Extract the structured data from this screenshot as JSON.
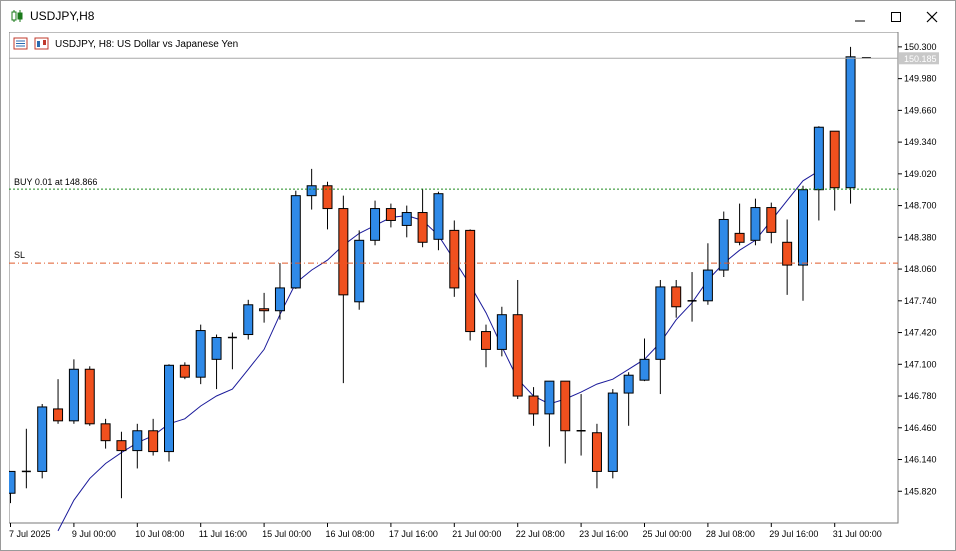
{
  "window": {
    "title": "USDJPY,H8",
    "controls": [
      "minimize",
      "maximize",
      "close"
    ]
  },
  "chart_header": {
    "text": "USDJPY, H8:  US Dollar vs Japanese Yen"
  },
  "price_lines": {
    "buy": {
      "label": "BUY 0.01 at 148.866",
      "price": 148.866,
      "color": "#1c8a1c"
    },
    "sl": {
      "label": "SL",
      "price": 148.12,
      "color": "#e05a2a"
    },
    "current": {
      "label": "150.185",
      "price": 150.185
    }
  },
  "colors": {
    "bull": "#2f8ae8",
    "bear": "#f0501e",
    "ma": "#1a1a9a",
    "wick": "#000000"
  },
  "chart_data": {
    "type": "candlestick",
    "symbol": "USDJPY",
    "timeframe": "H8",
    "ylim": [
      145.5,
      150.45
    ],
    "y_ticks": [
      150.3,
      149.98,
      149.66,
      149.34,
      149.02,
      148.7,
      148.38,
      148.06,
      147.74,
      147.42,
      147.1,
      146.78,
      146.46,
      146.14,
      145.82
    ],
    "x_ticks": [
      {
        "i": 0,
        "label": "7 Jul 2025"
      },
      {
        "i": 4,
        "label": "9 Jul 00:00"
      },
      {
        "i": 8,
        "label": "10 Jul 08:00"
      },
      {
        "i": 12,
        "label": "11 Jul 16:00"
      },
      {
        "i": 16,
        "label": "15 Jul 00:00"
      },
      {
        "i": 20,
        "label": "16 Jul 08:00"
      },
      {
        "i": 24,
        "label": "17 Jul 16:00"
      },
      {
        "i": 28,
        "label": "21 Jul 00:00"
      },
      {
        "i": 32,
        "label": "22 Jul 08:00"
      },
      {
        "i": 36,
        "label": "23 Jul 16:00"
      },
      {
        "i": 40,
        "label": "25 Jul 00:00"
      },
      {
        "i": 44,
        "label": "28 Jul 08:00"
      },
      {
        "i": 48,
        "label": "29 Jul 16:00"
      },
      {
        "i": 52,
        "label": "31 Jul 00:00"
      }
    ],
    "candles": [
      {
        "o": 145.8,
        "h": 146.02,
        "l": 145.7,
        "c": 146.02
      },
      {
        "o": 146.02,
        "h": 146.45,
        "l": 145.85,
        "c": 146.02
      },
      {
        "o": 146.02,
        "h": 146.7,
        "l": 145.95,
        "c": 146.67
      },
      {
        "o": 146.65,
        "h": 146.95,
        "l": 146.5,
        "c": 146.53
      },
      {
        "o": 146.53,
        "h": 147.15,
        "l": 146.5,
        "c": 147.05
      },
      {
        "o": 147.05,
        "h": 147.08,
        "l": 146.48,
        "c": 146.5
      },
      {
        "o": 146.5,
        "h": 146.55,
        "l": 146.25,
        "c": 146.33
      },
      {
        "o": 146.33,
        "h": 146.42,
        "l": 145.75,
        "c": 146.23
      },
      {
        "o": 146.23,
        "h": 146.5,
        "l": 146.05,
        "c": 146.43
      },
      {
        "o": 146.43,
        "h": 146.55,
        "l": 146.18,
        "c": 146.22
      },
      {
        "o": 146.22,
        "h": 147.1,
        "l": 146.12,
        "c": 147.09
      },
      {
        "o": 147.09,
        "h": 147.12,
        "l": 146.95,
        "c": 146.97
      },
      {
        "o": 146.97,
        "h": 147.5,
        "l": 146.9,
        "c": 147.44
      },
      {
        "o": 147.15,
        "h": 147.4,
        "l": 146.85,
        "c": 147.37
      },
      {
        "o": 147.37,
        "h": 147.42,
        "l": 147.05,
        "c": 147.37
      },
      {
        "o": 147.4,
        "h": 147.75,
        "l": 147.35,
        "c": 147.7
      },
      {
        "o": 147.66,
        "h": 147.82,
        "l": 147.52,
        "c": 147.64
      },
      {
        "o": 147.64,
        "h": 148.12,
        "l": 147.55,
        "c": 147.87
      },
      {
        "o": 147.87,
        "h": 148.85,
        "l": 147.86,
        "c": 148.8
      },
      {
        "o": 148.8,
        "h": 149.07,
        "l": 148.66,
        "c": 148.9
      },
      {
        "o": 148.9,
        "h": 148.94,
        "l": 148.46,
        "c": 148.67
      },
      {
        "o": 148.67,
        "h": 148.8,
        "l": 146.91,
        "c": 147.8
      },
      {
        "o": 147.73,
        "h": 148.45,
        "l": 147.65,
        "c": 148.35
      },
      {
        "o": 148.35,
        "h": 148.75,
        "l": 148.3,
        "c": 148.67
      },
      {
        "o": 148.67,
        "h": 148.72,
        "l": 148.48,
        "c": 148.55
      },
      {
        "o": 148.5,
        "h": 148.7,
        "l": 148.38,
        "c": 148.63
      },
      {
        "o": 148.63,
        "h": 148.87,
        "l": 148.28,
        "c": 148.33
      },
      {
        "o": 148.36,
        "h": 148.84,
        "l": 148.25,
        "c": 148.82
      },
      {
        "o": 148.45,
        "h": 148.55,
        "l": 147.78,
        "c": 147.87
      },
      {
        "o": 148.45,
        "h": 148.46,
        "l": 147.34,
        "c": 147.43
      },
      {
        "o": 147.43,
        "h": 147.5,
        "l": 147.07,
        "c": 147.25
      },
      {
        "o": 147.25,
        "h": 147.68,
        "l": 147.18,
        "c": 147.6
      },
      {
        "o": 147.6,
        "h": 147.95,
        "l": 146.75,
        "c": 146.78
      },
      {
        "o": 146.78,
        "h": 146.87,
        "l": 146.48,
        "c": 146.6
      },
      {
        "o": 146.6,
        "h": 146.93,
        "l": 146.27,
        "c": 146.93
      },
      {
        "o": 146.93,
        "h": 146.93,
        "l": 146.1,
        "c": 146.43
      },
      {
        "o": 146.43,
        "h": 146.8,
        "l": 146.18,
        "c": 146.43
      },
      {
        "o": 146.41,
        "h": 146.5,
        "l": 145.85,
        "c": 146.02
      },
      {
        "o": 146.02,
        "h": 146.85,
        "l": 145.95,
        "c": 146.81
      },
      {
        "o": 146.81,
        "h": 147.02,
        "l": 146.48,
        "c": 146.99
      },
      {
        "o": 146.94,
        "h": 147.36,
        "l": 146.93,
        "c": 147.15
      },
      {
        "o": 147.15,
        "h": 147.95,
        "l": 146.8,
        "c": 147.88
      },
      {
        "o": 147.88,
        "h": 147.95,
        "l": 147.57,
        "c": 147.68
      },
      {
        "o": 147.74,
        "h": 148.03,
        "l": 147.53,
        "c": 147.74
      },
      {
        "o": 147.74,
        "h": 148.32,
        "l": 147.7,
        "c": 148.05
      },
      {
        "o": 148.05,
        "h": 148.64,
        "l": 147.98,
        "c": 148.56
      },
      {
        "o": 148.42,
        "h": 148.72,
        "l": 148.3,
        "c": 148.33
      },
      {
        "o": 148.35,
        "h": 148.77,
        "l": 148.3,
        "c": 148.68
      },
      {
        "o": 148.68,
        "h": 148.73,
        "l": 148.32,
        "c": 148.43
      },
      {
        "o": 148.33,
        "h": 148.56,
        "l": 147.8,
        "c": 148.1
      },
      {
        "o": 148.1,
        "h": 148.9,
        "l": 147.74,
        "c": 148.86
      },
      {
        "o": 148.86,
        "h": 149.5,
        "l": 148.55,
        "c": 149.49
      },
      {
        "o": 149.45,
        "h": 149.45,
        "l": 148.65,
        "c": 148.88
      },
      {
        "o": 148.88,
        "h": 150.3,
        "l": 148.72,
        "c": 150.2
      },
      {
        "o": 150.19,
        "h": 150.19,
        "l": 150.19,
        "c": 150.19
      }
    ],
    "ma_line": [
      {
        "i": 3,
        "v": 145.42
      },
      {
        "i": 4,
        "v": 145.73
      },
      {
        "i": 5,
        "v": 145.95
      },
      {
        "i": 6,
        "v": 146.1
      },
      {
        "i": 7,
        "v": 146.21
      },
      {
        "i": 8,
        "v": 146.31
      },
      {
        "i": 9,
        "v": 146.38
      },
      {
        "i": 10,
        "v": 146.5
      },
      {
        "i": 11,
        "v": 146.55
      },
      {
        "i": 12,
        "v": 146.68
      },
      {
        "i": 13,
        "v": 146.78
      },
      {
        "i": 14,
        "v": 146.85
      },
      {
        "i": 15,
        "v": 147.05
      },
      {
        "i": 16,
        "v": 147.25
      },
      {
        "i": 17,
        "v": 147.6
      },
      {
        "i": 18,
        "v": 147.92
      },
      {
        "i": 19,
        "v": 148.05
      },
      {
        "i": 20,
        "v": 148.15
      },
      {
        "i": 21,
        "v": 148.3
      },
      {
        "i": 22,
        "v": 148.42
      },
      {
        "i": 23,
        "v": 148.5
      },
      {
        "i": 24,
        "v": 148.58
      },
      {
        "i": 25,
        "v": 148.6
      },
      {
        "i": 26,
        "v": 148.55
      },
      {
        "i": 27,
        "v": 148.4
      },
      {
        "i": 28,
        "v": 148.15
      },
      {
        "i": 29,
        "v": 147.9
      },
      {
        "i": 30,
        "v": 147.62
      },
      {
        "i": 31,
        "v": 147.28
      },
      {
        "i": 32,
        "v": 146.95
      },
      {
        "i": 33,
        "v": 146.78
      },
      {
        "i": 34,
        "v": 146.7
      },
      {
        "i": 35,
        "v": 146.75
      },
      {
        "i": 36,
        "v": 146.82
      },
      {
        "i": 37,
        "v": 146.9
      },
      {
        "i": 38,
        "v": 146.95
      },
      {
        "i": 39,
        "v": 147.05
      },
      {
        "i": 40,
        "v": 147.15
      },
      {
        "i": 41,
        "v": 147.32
      },
      {
        "i": 42,
        "v": 147.55
      },
      {
        "i": 43,
        "v": 147.72
      },
      {
        "i": 44,
        "v": 147.95
      },
      {
        "i": 45,
        "v": 148.12
      },
      {
        "i": 46,
        "v": 148.25
      },
      {
        "i": 47,
        "v": 148.35
      },
      {
        "i": 48,
        "v": 148.55
      },
      {
        "i": 49,
        "v": 148.75
      },
      {
        "i": 50,
        "v": 148.95
      },
      {
        "i": 51,
        "v": 149.05
      }
    ]
  }
}
